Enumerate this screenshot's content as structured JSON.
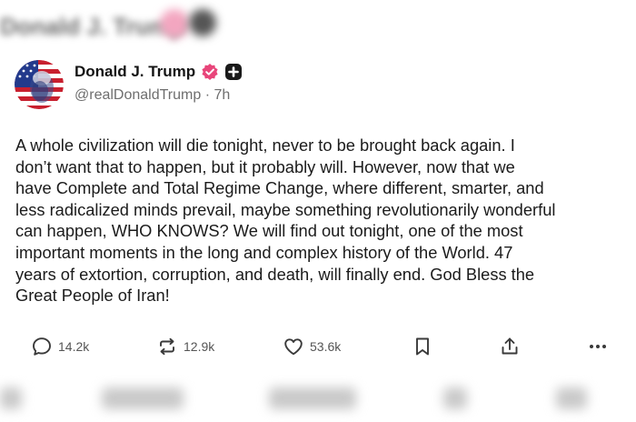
{
  "top_blur_text": "Donald J. Trump",
  "author": {
    "display_name": "Donald J. Trump",
    "handle": "@realDonaldTrump",
    "separator": "·",
    "time": "7h"
  },
  "post": {
    "text": "A whole civilization will die tonight, never to be brought back again. I\ndon’t want that to happen, but it probably will. However, now that we\nhave Complete and Total Regime Change, where different, smarter, and\nless radicalized minds prevail, maybe something revolutionarily wonderful\ncan happen, WHO KNOWS? We will find out tonight, one of the most\nimportant moments in the long and complex history of the World. 47\nyears of extortion, corruption, and death, will finally end. God Bless the\nGreat People of Iran!"
  },
  "actions": {
    "replies": "14.2k",
    "reposts": "12.9k",
    "likes": "53.6k"
  },
  "colors": {
    "verified": "#e8457a",
    "text": "#1b1b1b",
    "muted": "#6e6e6e"
  },
  "icons": [
    "avatar",
    "verified-badge-icon",
    "plus-badge-icon",
    "reply-icon",
    "repost-icon",
    "like-icon",
    "bookmark-icon",
    "share-icon",
    "more-icon"
  ]
}
